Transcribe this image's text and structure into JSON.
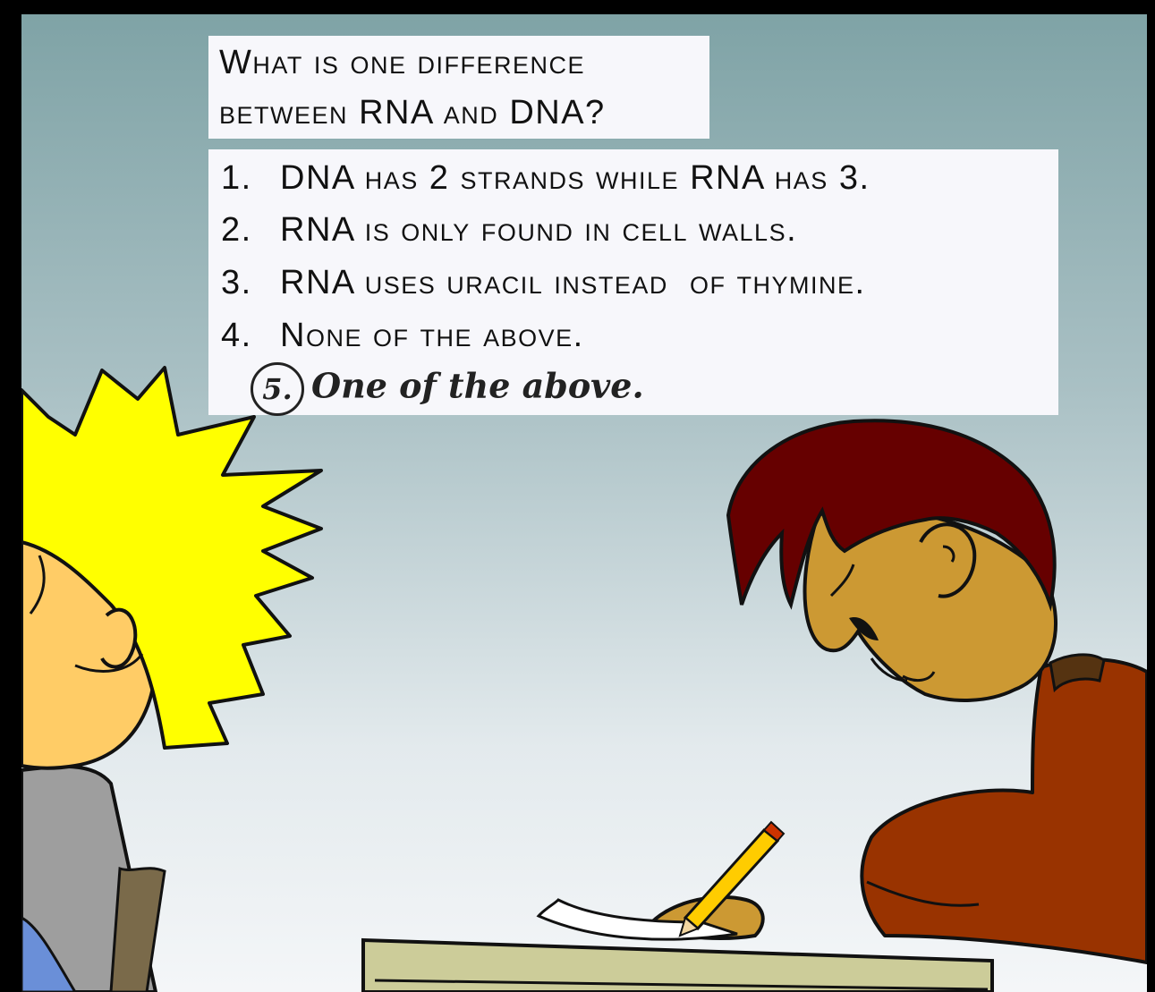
{
  "question": {
    "line1": "What is one difference",
    "line2": "between RNA and DNA?"
  },
  "answers": [
    {
      "num": "1.",
      "text": "DNA has 2 strands while RNA has 3."
    },
    {
      "num": "2.",
      "text": "RNA is only found in cell walls."
    },
    {
      "num": "3.",
      "text": "RNA uses uracil instead  of thymine."
    },
    {
      "num": "4.",
      "text": "None of the above."
    }
  ],
  "written_answer": {
    "num": "5.",
    "text": "One of the above."
  },
  "colors": {
    "background_top": "#7fa3a6",
    "background_bottom": "#f4f6f8",
    "caption_box": "#f7f7fb",
    "blond_hair": "#ffff00",
    "skin_light": "#ffcc66",
    "shirt_gray": "#9e9e9e",
    "red_hair": "#660000",
    "skin_tan": "#cc9933",
    "shirt_red": "#993300",
    "desk": "#cccc99",
    "pencil": "#ffcc00"
  },
  "icons": [
    "student-blond",
    "student-redhead",
    "desk",
    "pencil",
    "paper"
  ]
}
